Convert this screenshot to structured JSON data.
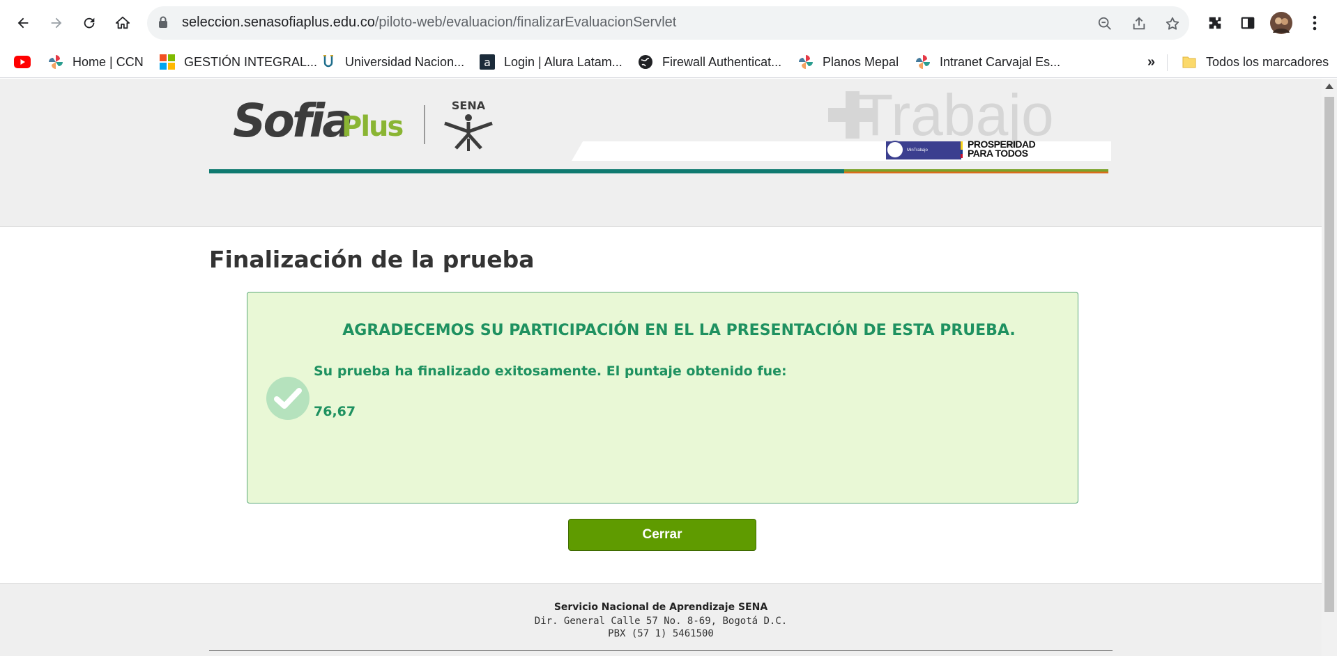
{
  "browser": {
    "url_host": "seleccion.senasofiaplus.edu.co",
    "url_path": "/piloto-web/evaluacion/finalizarEvaluacionServlet",
    "bookmarks": [
      {
        "label": "Home | CCN",
        "icon": "pinwheel-icon"
      },
      {
        "label": "GESTIÓN INTEGRAL...",
        "icon": "microsoft-icon"
      },
      {
        "label": "Universidad Nacion...",
        "icon": "university-icon"
      },
      {
        "label": "Login | Alura Latam...",
        "icon": "alura-icon"
      },
      {
        "label": "Firewall Authenticat...",
        "icon": "globe-icon"
      },
      {
        "label": "Planos Mepal",
        "icon": "pinwheel-icon"
      },
      {
        "label": "Intranet Carvajal Es...",
        "icon": "pinwheel-icon"
      }
    ],
    "overflow_label": "»",
    "all_bookmarks_label": "Todos los marcadores"
  },
  "banner": {
    "logo_sofia": "Sofia",
    "logo_plus": "Plus",
    "logo_sena": "SENA",
    "slogan": "Trabajo",
    "ministry": "MinTrabajo",
    "prosperidad_line1": "PROSPERIDAD",
    "prosperidad_line2": "PARA TODOS"
  },
  "main": {
    "title": "Finalización de la prueba",
    "heading": "AGRADECEMOS SU PARTICIPACIÓN EN EL LA PRESENTACIÓN DE ESTA PRUEBA.",
    "result_text": "Su prueba ha finalizado exitosamente. El puntaje obtenido fue:",
    "score": "76,67",
    "close_label": "Cerrar"
  },
  "footer": {
    "org": "Servicio Nacional de Aprendizaje SENA",
    "address": "Dir. General Calle 57 No. 8-69, Bogotá D.C.",
    "phone": "PBX (57 1) 5461500"
  },
  "colors": {
    "success_green": "#1e9160",
    "box_bg": "#e9f8d6",
    "button_green": "#5f9b00",
    "stripe_teal": "#0f7a70"
  }
}
